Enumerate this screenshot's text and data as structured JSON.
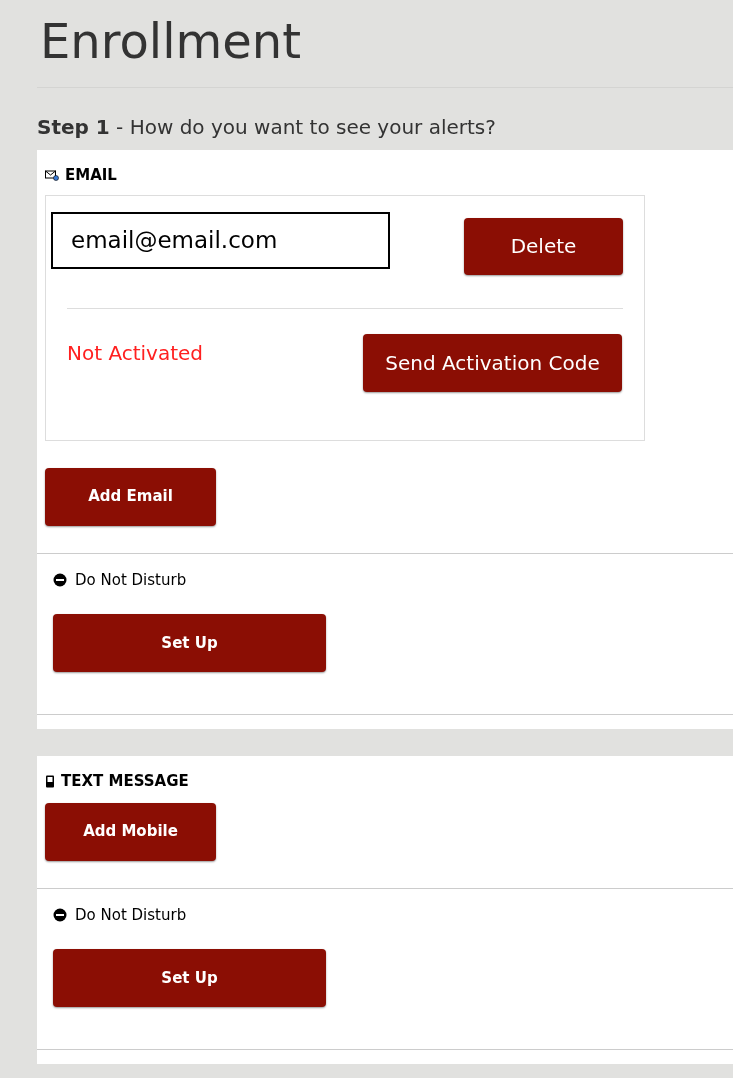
{
  "page_title": "Enrollment",
  "step": "**Step 1** - How do you want to see your alerts?",
  "channels": [
    {
      "kind": "email",
      "title": "EMAIL",
      "entries": [
        {
          "value": "email@email.com",
          "delete_label": "Delete",
          "status": "Not Activated",
          "send_label": "Send Activation Code"
        }
      ],
      "add_label": "Add Email",
      "dnd_label": "Do Not Disturb",
      "setup_label": "Set Up"
    },
    {
      "kind": "text",
      "title": "TEXT MESSAGE",
      "add_label": "Add Mobile",
      "dnd_label": "Do Not Disturb",
      "setup_label": "Set Up"
    }
  ]
}
